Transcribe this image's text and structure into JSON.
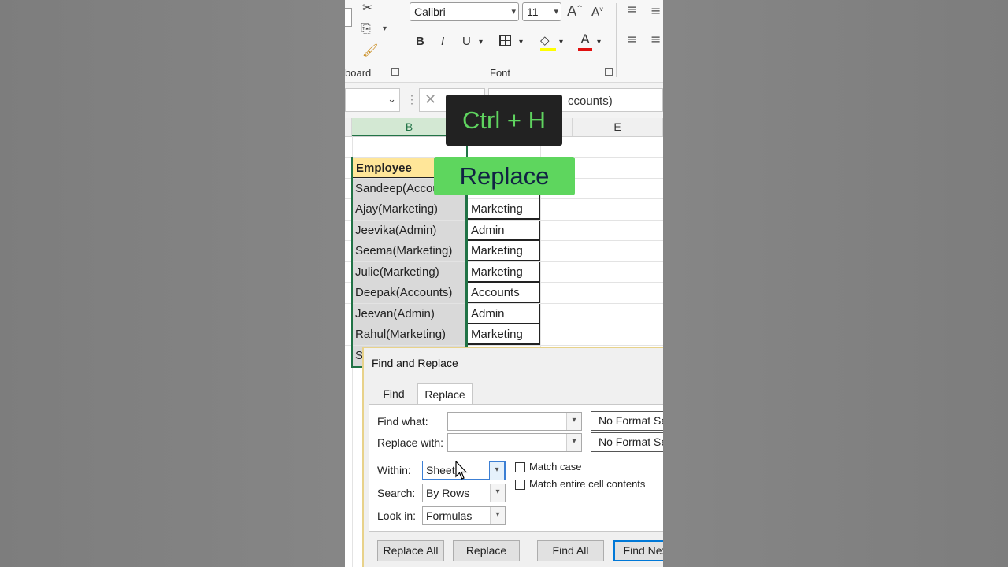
{
  "ribbon": {
    "font_name": "Calibri",
    "font_size": "11",
    "bold": "B",
    "italic": "I",
    "underline": "U",
    "font_color_letter": "A",
    "grow_font": "A",
    "shrink_font": "A",
    "clipboard_label": "board",
    "font_group_label": "Font"
  },
  "formula_bar": {
    "content": "ccounts)"
  },
  "columns": [
    "B",
    "E"
  ],
  "table": {
    "header": "Employee",
    "rows": [
      {
        "b": "Sandeep(Accounts)",
        "c": ""
      },
      {
        "b": "Ajay(Marketing)",
        "c": "Marketing"
      },
      {
        "b": "Jeevika(Admin)",
        "c": "Admin"
      },
      {
        "b": "Seema(Marketing)",
        "c": "Marketing"
      },
      {
        "b": "Julie(Marketing)",
        "c": "Marketing"
      },
      {
        "b": "Deepak(Accounts)",
        "c": "Accounts"
      },
      {
        "b": "Jeevan(Admin)",
        "c": "Admin"
      },
      {
        "b": "Rahul(Marketing)",
        "c": "Marketing"
      },
      {
        "b": "S",
        "c": ""
      }
    ]
  },
  "overlays": {
    "shortcut": "Ctrl + H",
    "action": "Replace"
  },
  "dialog": {
    "title": "Find and Replace",
    "tabs": [
      "Find",
      "Replace"
    ],
    "active_tab": "Replace",
    "find_what_label": "Find what:",
    "replace_with_label": "Replace with:",
    "find_what_value": "",
    "replace_with_value": "",
    "no_format_label": "No Format Set",
    "within_label": "Within:",
    "within_value": "Sheet",
    "search_label": "Search:",
    "search_value": "By Rows",
    "look_in_label": "Look in:",
    "look_in_value": "Formulas",
    "match_case_label": "Match case",
    "match_entire_label": "Match entire cell contents",
    "match_case_checked": false,
    "match_entire_checked": false,
    "buttons": {
      "replace_all": "Replace All",
      "replace": "Replace",
      "find_all": "Find All",
      "find_next": "Find Next"
    }
  },
  "colors": {
    "accent_green": "#217346",
    "header_fill": "#ffe699",
    "overlay_dark": "#222222",
    "overlay_green": "#5ed65e",
    "overlay_text_green": "#5fd35f",
    "focus_blue": "#0078d7"
  }
}
